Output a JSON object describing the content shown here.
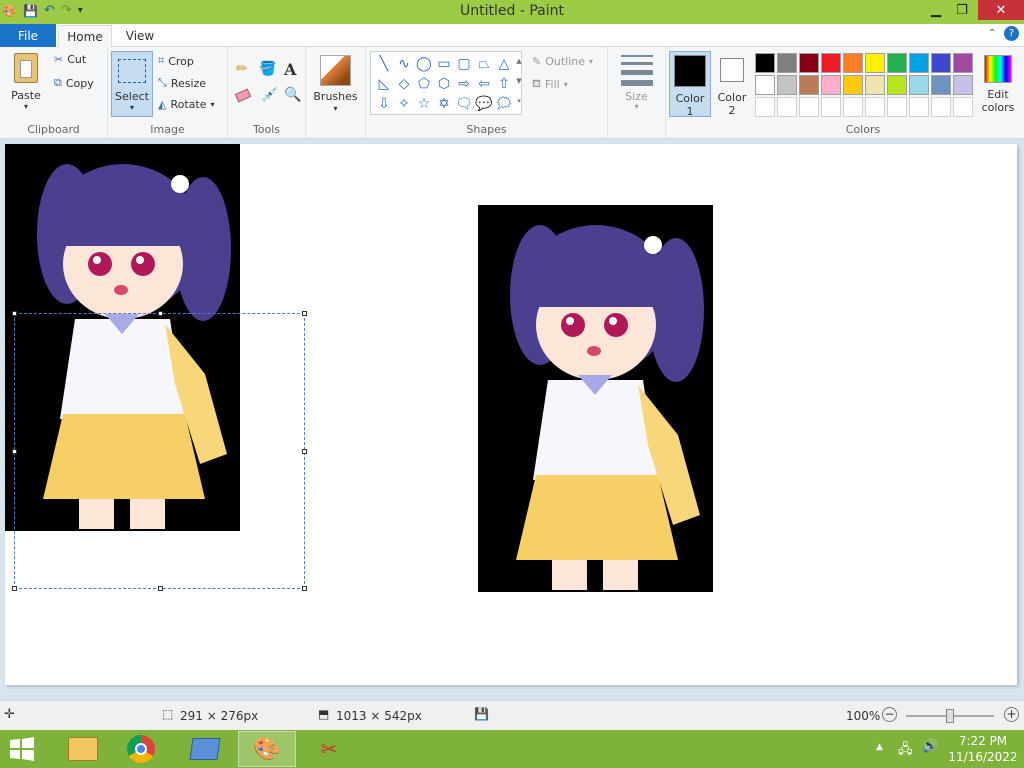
{
  "window": {
    "title": "Untitled - Paint"
  },
  "tabs": {
    "file": "File",
    "home": "Home",
    "view": "View"
  },
  "clipboard": {
    "paste": "Paste",
    "cut": "Cut",
    "copy": "Copy",
    "label": "Clipboard"
  },
  "image": {
    "select": "Select",
    "crop": "Crop",
    "resize": "Resize",
    "rotate": "Rotate",
    "label": "Image"
  },
  "tools": {
    "label": "Tools",
    "text_glyph": "A"
  },
  "brushes": {
    "label": "Brushes"
  },
  "shapes": {
    "outline": "Outline",
    "fill": "Fill",
    "label": "Shapes"
  },
  "size": {
    "label": "Size"
  },
  "color1": {
    "line1": "Color",
    "line2": "1"
  },
  "color2": {
    "line1": "Color",
    "line2": "2"
  },
  "colors": {
    "label": "Colors",
    "edit_line1": "Edit",
    "edit_line2": "colors",
    "row1": [
      "#000000",
      "#7f7f7f",
      "#880015",
      "#ed1c24",
      "#ff7f27",
      "#fff200",
      "#22b14c",
      "#00a2e8",
      "#3f48cc",
      "#a349a4"
    ],
    "row2": [
      "#ffffff",
      "#c3c3c3",
      "#b97a57",
      "#ffaec9",
      "#ffc90e",
      "#efe4b0",
      "#b5e61d",
      "#99d9ea",
      "#7092be",
      "#c8bfe7"
    ],
    "primary": "#000000",
    "secondary": "#ffffff"
  },
  "status": {
    "selection_size": "291 × 276px",
    "image_size": "1013 × 542px",
    "zoom": "100%"
  },
  "taskbar": {
    "time": "7:22 PM",
    "date": "11/16/2022"
  }
}
